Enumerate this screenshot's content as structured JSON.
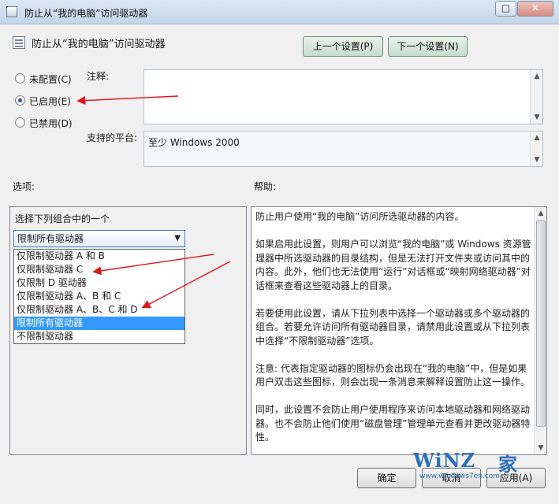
{
  "window": {
    "title": "防止从“我的电脑”访问驱动器",
    "maximize_glyph": "□",
    "close_glyph": "✕"
  },
  "header": {
    "policy_title": "防止从“我的电脑”访问驱动器",
    "prev_button": "上一个设置(P)",
    "next_button": "下一个设置(N)"
  },
  "state": {
    "not_configured": "未配置(C)",
    "enabled": "已启用(E)",
    "disabled": "已禁用(D)",
    "selected": "enabled"
  },
  "comment": {
    "label": "注释:",
    "value": ""
  },
  "platform": {
    "label": "支持的平台:",
    "value": "至少 Windows 2000"
  },
  "options": {
    "heading": "选项:",
    "group_label": "选择下列组合中的一个",
    "combo_value": "限制所有驱动器",
    "combo_arrow": "▼",
    "items": [
      "仅限制驱动器 A 和 B",
      "仅限制驱动器 C",
      "仅限制 D 驱动器",
      "仅限制驱动器 A、B 和 C",
      "仅限制驱动器 A、B、C 和 D",
      "限制所有驱动器",
      "不限制驱动器"
    ],
    "selected_index": 5
  },
  "help": {
    "heading": "帮助:",
    "paragraphs": [
      "防止用户使用“我的电脑”访问所选驱动器的内容。",
      "如果启用此设置，则用户可以浏览“我的电脑”或 Windows 资源管理器中所选驱动器的目录结构，但是无法打开文件夹或访问其中的内容。此外，他们也无法使用“运行”对话框或“映射网络驱动器”对话框来查看这些驱动器上的目录。",
      "若要使用此设置，请从下拉列表中选择一个驱动器或多个驱动器的组合。若要允许访问所有驱动器目录，请禁用此设置或从下拉列表中选择“不限制驱动器”选项。",
      "注意: 代表指定驱动器的图标仍会出现在“我的电脑”中，但是如果用户双击这些图标，则会出现一条消息来解释设置防止这一操作。",
      "同时，此设置不会防止用户使用程序来访问本地驱动器和网络驱动器。也不会防止他们使用“磁盘管理”管理单元查看并更改驱动器特性。"
    ]
  },
  "footer": {
    "ok": "确定",
    "cancel": "取消",
    "apply": "应用(A)"
  },
  "watermark": {
    "brand": "WiNZ",
    "char": "家",
    "url": "www.windows7en.com"
  },
  "scroll_glyphs": {
    "up": "▲",
    "down": "▼"
  },
  "colors": {
    "annotation_arrow": "#e0141b",
    "selection": "#3399ff"
  }
}
